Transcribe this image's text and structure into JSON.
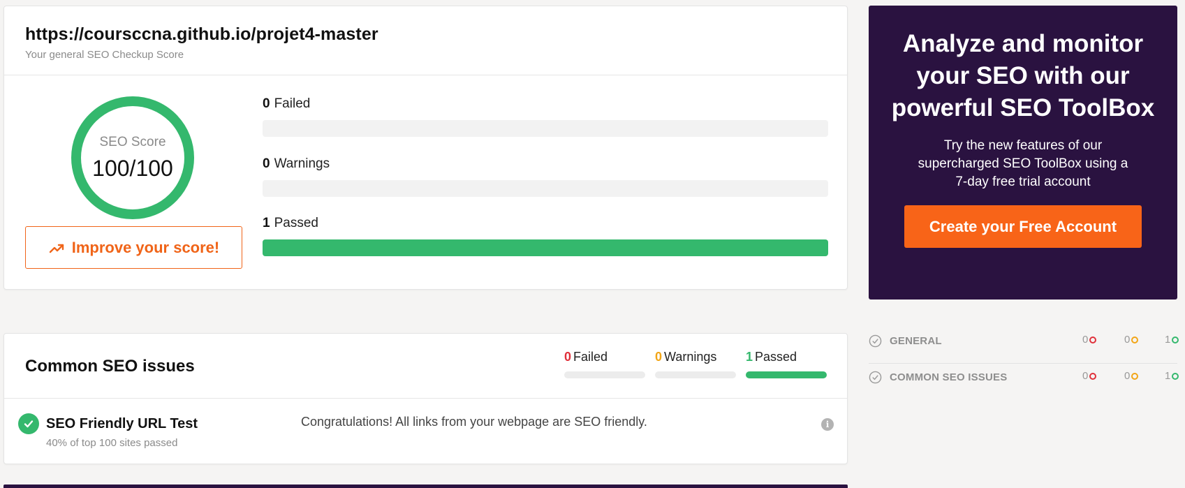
{
  "header": {
    "url": "https://courscсna.github.io/projet4-master",
    "subtitle": "Your general SEO Checkup Score"
  },
  "score": {
    "label": "SEO Score",
    "value": "100/100",
    "improve_label": "Improve your score!",
    "improve_icon": "trending-up-icon"
  },
  "stats": [
    {
      "count": "0",
      "label": "Failed",
      "fraction": 0
    },
    {
      "count": "0",
      "label": "Warnings",
      "fraction": 0
    },
    {
      "count": "1",
      "label": "Passed",
      "fraction": 1
    }
  ],
  "promo": {
    "title": "Analyze and monitor your SEO with our powerful SEO ToolBox",
    "text": "Try the new features of our supercharged SEO ToolBox using a 7-day free trial account",
    "button": "Create your Free Account"
  },
  "issues": {
    "title": "Common SEO issues",
    "summary": [
      {
        "count": "0",
        "label": "Failed",
        "color": "#e0303a",
        "fraction": 0
      },
      {
        "count": "0",
        "label": "Warnings",
        "color": "#f2a516",
        "fraction": 0
      },
      {
        "count": "1",
        "label": "Passed",
        "color": "#34b86d",
        "fraction": 1
      }
    ],
    "rows": [
      {
        "title": "SEO Friendly URL Test",
        "sub": "40% of top 100 sites passed",
        "message": "Congratulations! All links from your webpage are SEO friendly.",
        "status_icon": "check-icon",
        "info_icon": "info-icon"
      }
    ]
  },
  "sidebar": {
    "items": [
      {
        "label": "GENERAL",
        "failed": "0",
        "warnings": "0",
        "passed": "1"
      },
      {
        "label": "COMMON SEO ISSUES",
        "failed": "0",
        "warnings": "0",
        "passed": "1"
      }
    ]
  },
  "colors": {
    "accent_orange": "#f06418",
    "success_green": "#34b86d",
    "promo_bg": "#2a1240",
    "failed_red": "#e0303a",
    "warning_yellow": "#f2a516"
  }
}
